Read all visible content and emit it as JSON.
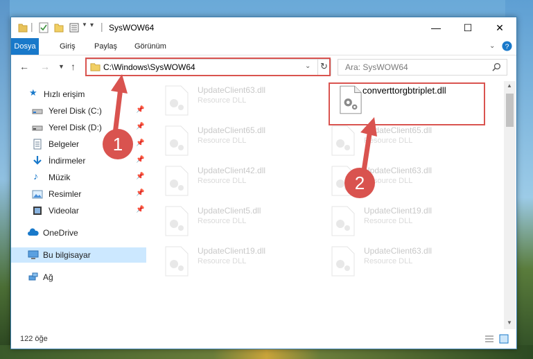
{
  "window": {
    "title": "SysWOW64",
    "controls": {
      "minimize": "—",
      "maximize": "☐",
      "close": "✕"
    }
  },
  "ribbon": {
    "tabs": [
      "Dosya",
      "Giriş",
      "Paylaş",
      "Görünüm"
    ]
  },
  "navigation": {
    "address": "C:\\Windows\\SysWOW64",
    "search_placeholder": "Ara: SysWOW64"
  },
  "sidebar": {
    "quick_access": "Hızlı erişim",
    "items": [
      {
        "label": "Yerel Disk (C:)",
        "icon": "drive-icon"
      },
      {
        "label": "Yerel Disk (D:)",
        "icon": "drive-icon"
      },
      {
        "label": "Belgeler",
        "icon": "documents-icon"
      },
      {
        "label": "İndirmeler",
        "icon": "downloads-icon"
      },
      {
        "label": "Müzik",
        "icon": "music-icon"
      },
      {
        "label": "Resimler",
        "icon": "pictures-icon"
      },
      {
        "label": "Videolar",
        "icon": "videos-icon"
      }
    ],
    "onedrive": "OneDrive",
    "this_pc": "Bu bilgisayar",
    "network": "Ağ"
  },
  "files": {
    "highlighted": "converttorgbtriplet.dll",
    "left_column": [
      {
        "name": "UpdateClient63.dll",
        "type": "Resource DLL"
      },
      {
        "name": "UpdateClient65.dll",
        "type": "Resource DLL"
      },
      {
        "name": "UpdateClient42.dll",
        "type": "Resource DLL"
      },
      {
        "name": "UpdateClient5.dll",
        "type": "Resource DLL"
      },
      {
        "name": "UpdateClient19.dll",
        "type": "Resource DLL"
      }
    ],
    "right_column": [
      {
        "name": "UpdateClient65.dll",
        "type": "Resource DLL"
      },
      {
        "name": "UpdateClient63.dll",
        "type": "Resource DLL"
      },
      {
        "name": "UpdateClient19.dll",
        "type": "Resource DLL"
      },
      {
        "name": "UpdateClient63.dll",
        "type": "Resource DLL"
      }
    ]
  },
  "status": {
    "item_count": "122 öğe"
  },
  "annotations": {
    "step1": "1",
    "step2": "2"
  },
  "colors": {
    "accent": "#1979ca",
    "highlight": "#d9534f",
    "selection": "#cce8ff"
  }
}
